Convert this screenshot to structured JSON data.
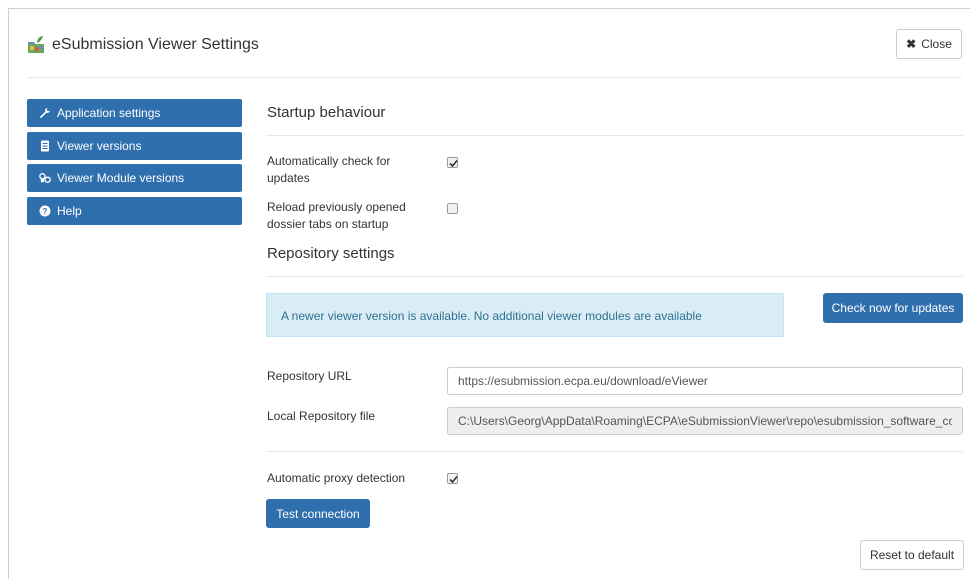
{
  "header": {
    "title": "eSubmission Viewer Settings",
    "logo_icon": "folder-leaf-icon",
    "close_label": "Close"
  },
  "sidebar": {
    "items": [
      {
        "label": "Application settings",
        "icon": "wrench-icon"
      },
      {
        "label": "Viewer versions",
        "icon": "file-icon"
      },
      {
        "label": "Viewer Module versions",
        "icon": "cubes-icon"
      },
      {
        "label": "Help",
        "icon": "question-circle-icon"
      }
    ]
  },
  "startup": {
    "title": "Startup behaviour",
    "auto_check_label": "Automatically check for updates",
    "auto_check_checked": true,
    "reload_label": "Reload previously opened dossier tabs on startup",
    "reload_checked": false
  },
  "repository": {
    "title": "Repository settings",
    "alert_text": "A newer viewer version is available. No additional viewer modules are available",
    "check_button": "Check now for updates",
    "url_label": "Repository URL",
    "url_value": "https://esubmission.ecpa.eu/download/eViewer",
    "local_label": "Local Repository file",
    "local_value": "C:\\Users\\Georg\\AppData\\Roaming\\ECPA\\eSubmissionViewer\\repo\\esubmission_software_configi",
    "proxy_label": "Automatic proxy detection",
    "proxy_checked": true,
    "test_button": "Test connection"
  },
  "footer": {
    "reset_button": "Reset to default"
  },
  "colors": {
    "primary": "#2f6fae",
    "alert_bg": "#d9edf7",
    "alert_text": "#31708f"
  }
}
